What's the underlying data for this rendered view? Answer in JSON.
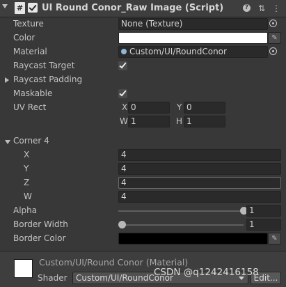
{
  "header": {
    "script_icon": "#",
    "title": "UI Round Conor_Raw Image (Script)",
    "help_icon": "?",
    "settings_icon": "⇅",
    "menu_icon": "⋮"
  },
  "properties": {
    "texture": {
      "label": "Texture",
      "value": "None (Texture)"
    },
    "color": {
      "label": "Color",
      "value": "#ffffff"
    },
    "material": {
      "label": "Material",
      "value": "Custom/UI/RoundConor"
    },
    "raycast_target": {
      "label": "Raycast Target",
      "checked": true
    },
    "raycast_padding": {
      "label": "Raycast Padding"
    },
    "maskable": {
      "label": "Maskable",
      "checked": true
    },
    "uv_rect": {
      "label": "UV Rect",
      "x_label": "X",
      "x": "0",
      "y_label": "Y",
      "y": "0",
      "w_label": "W",
      "w": "1",
      "h_label": "H",
      "h": "1"
    },
    "corner": {
      "label": "Corner 4",
      "x_label": "X",
      "x": "4",
      "y_label": "Y",
      "y": "4",
      "z_label": "Z",
      "z": "4",
      "w_label": "W",
      "w": "4"
    },
    "alpha": {
      "label": "Alpha",
      "value": "1",
      "level": 1.0
    },
    "border_width": {
      "label": "Border Width",
      "value": "1",
      "level": 0.0
    },
    "border_color": {
      "label": "Border Color",
      "value": "#000000"
    }
  },
  "material_footer": {
    "name": "Custom/UI/Round Conor (Material)",
    "shader_label": "Shader",
    "shader_value": "Custom/UI/RoundConor",
    "edit_label": "Edit..."
  },
  "watermark": "CSDN @q1242416158"
}
